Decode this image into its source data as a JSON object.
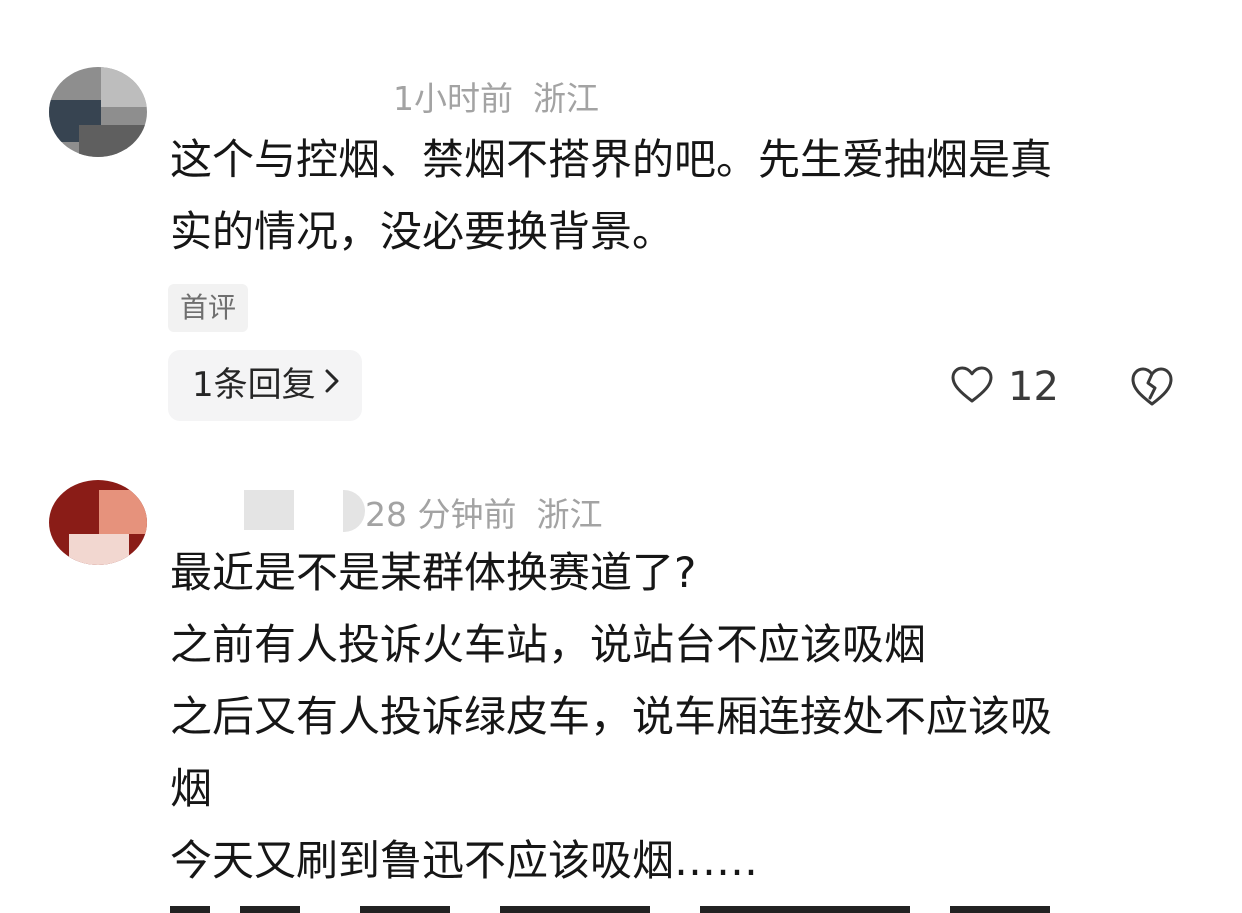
{
  "comments": [
    {
      "time": "1小时前",
      "location": "浙江",
      "lines": [
        "这个与控烟、禁烟不搭界的吧。先生爱抽烟是真",
        "实的情况，没必要换背景。"
      ],
      "badge": "首评",
      "reply_label": "1条回复",
      "like_count": "12",
      "icons": {
        "like": "heart-outline-icon",
        "dislike": "broken-heart-icon",
        "chevron": "chevron-right-icon"
      }
    },
    {
      "time": "28 分钟前",
      "location": "浙江",
      "lines": [
        "最近是不是某群体换赛道了?",
        "之前有人投诉火车站，说站台不应该吸烟",
        "之后又有人投诉绿皮车，说车厢连接处不应该吸",
        "烟",
        "今天又刷到鲁迅不应该吸烟……"
      ]
    }
  ],
  "colors": {
    "meta_text": "#a3a3a3",
    "body_text": "#161616",
    "badge_bg": "#f2f2f2",
    "reply_bg": "#f4f4f5"
  }
}
